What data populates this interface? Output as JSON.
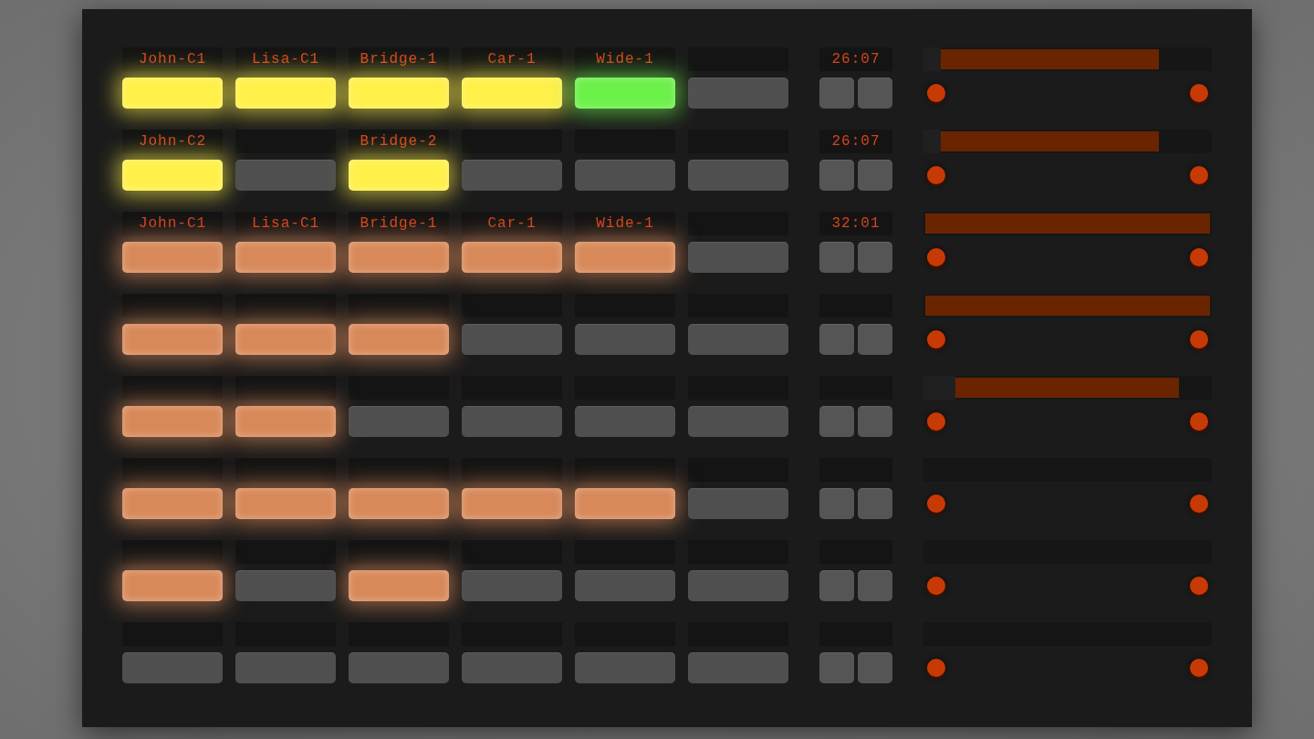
{
  "rows": [
    {
      "slots": [
        {
          "label": "John-C1",
          "lit": true,
          "color": "#fff04a"
        },
        {
          "label": "Lisa-C1",
          "lit": true,
          "color": "#fff04a"
        },
        {
          "label": "Bridge-1",
          "lit": true,
          "color": "#fff04a"
        },
        {
          "label": "Car-1",
          "lit": true,
          "color": "#fff04a"
        },
        {
          "label": "Wide-1",
          "lit": true,
          "color": "#6cf04a"
        },
        {
          "lit": false,
          "color": "#555555"
        }
      ],
      "time": "26:07",
      "bar": {
        "lead": {
          "level": 0.06
        },
        "fill": {
          "level": 0.82
        }
      }
    },
    {
      "slots": [
        {
          "label": "John-C2",
          "lit": true,
          "color": "#fff04a"
        },
        {
          "lit": false,
          "color": "#555555"
        },
        {
          "label": "Bridge-2",
          "lit": true,
          "color": "#fff04a"
        },
        {
          "lit": false,
          "color": "#555555"
        },
        {
          "lit": false,
          "color": "#555555"
        },
        {
          "lit": false,
          "color": "#555555"
        }
      ],
      "time": "26:07",
      "bar": {
        "lead": {
          "level": 0.06
        },
        "fill": {
          "level": 0.82
        }
      }
    },
    {
      "slots": [
        {
          "label": "John-C1",
          "lit": true,
          "color": "#d8895a"
        },
        {
          "label": "Lisa-C1",
          "lit": true,
          "color": "#d8895a"
        },
        {
          "label": "Bridge-1",
          "lit": true,
          "color": "#d8895a"
        },
        {
          "label": "Car-1",
          "lit": true,
          "color": "#d8895a"
        },
        {
          "label": "Wide-1",
          "lit": true,
          "color": "#d8895a"
        },
        {
          "lit": false,
          "color": "#555555"
        }
      ],
      "time": "32:01",
      "bar": {
        "fill": {
          "level": 1
        }
      }
    },
    {
      "slots": [
        {
          "lit": true,
          "color": "#d8895a"
        },
        {
          "lit": true,
          "color": "#d8895a"
        },
        {
          "lit": true,
          "color": "#d8895a"
        },
        {
          "lit": false,
          "color": "#555555"
        },
        {
          "lit": false,
          "color": "#555555"
        },
        {
          "lit": false,
          "color": "#555555"
        }
      ],
      "bar": {
        "fill": {
          "level": 1
        }
      }
    },
    {
      "slots": [
        {
          "lit": true,
          "color": "#d8895a"
        },
        {
          "lit": true,
          "color": "#d8895a"
        },
        {
          "lit": false,
          "color": "#555555"
        },
        {
          "lit": false,
          "color": "#555555"
        },
        {
          "lit": false,
          "color": "#555555"
        },
        {
          "lit": false,
          "color": "#555555"
        }
      ],
      "bar": {
        "lead": {
          "level": 0.11
        },
        "fill": {
          "level": 0.89
        }
      }
    },
    {
      "slots": [
        {
          "lit": true,
          "color": "#d8895a"
        },
        {
          "lit": true,
          "color": "#d8895a"
        },
        {
          "lit": true,
          "color": "#d8895a"
        },
        {
          "lit": true,
          "color": "#d8895a"
        },
        {
          "lit": true,
          "color": "#d8895a"
        },
        {
          "lit": false,
          "color": "#555555"
        }
      ]
    },
    {
      "slots": [
        {
          "lit": true,
          "color": "#d8895a"
        },
        {
          "lit": false,
          "color": "#555555"
        },
        {
          "lit": true,
          "color": "#d8895a"
        },
        {
          "lit": false,
          "color": "#555555"
        },
        {
          "lit": false,
          "color": "#555555"
        },
        {
          "lit": false,
          "color": "#555555"
        }
      ]
    },
    {
      "slots": [
        {
          "lit": false,
          "color": "#555555"
        },
        {
          "lit": false,
          "color": "#555555"
        },
        {
          "lit": false,
          "color": "#555555"
        },
        {
          "lit": false,
          "color": "#555555"
        },
        {
          "lit": false,
          "color": "#555555"
        },
        {
          "lit": false,
          "color": "#555555"
        }
      ]
    }
  ]
}
